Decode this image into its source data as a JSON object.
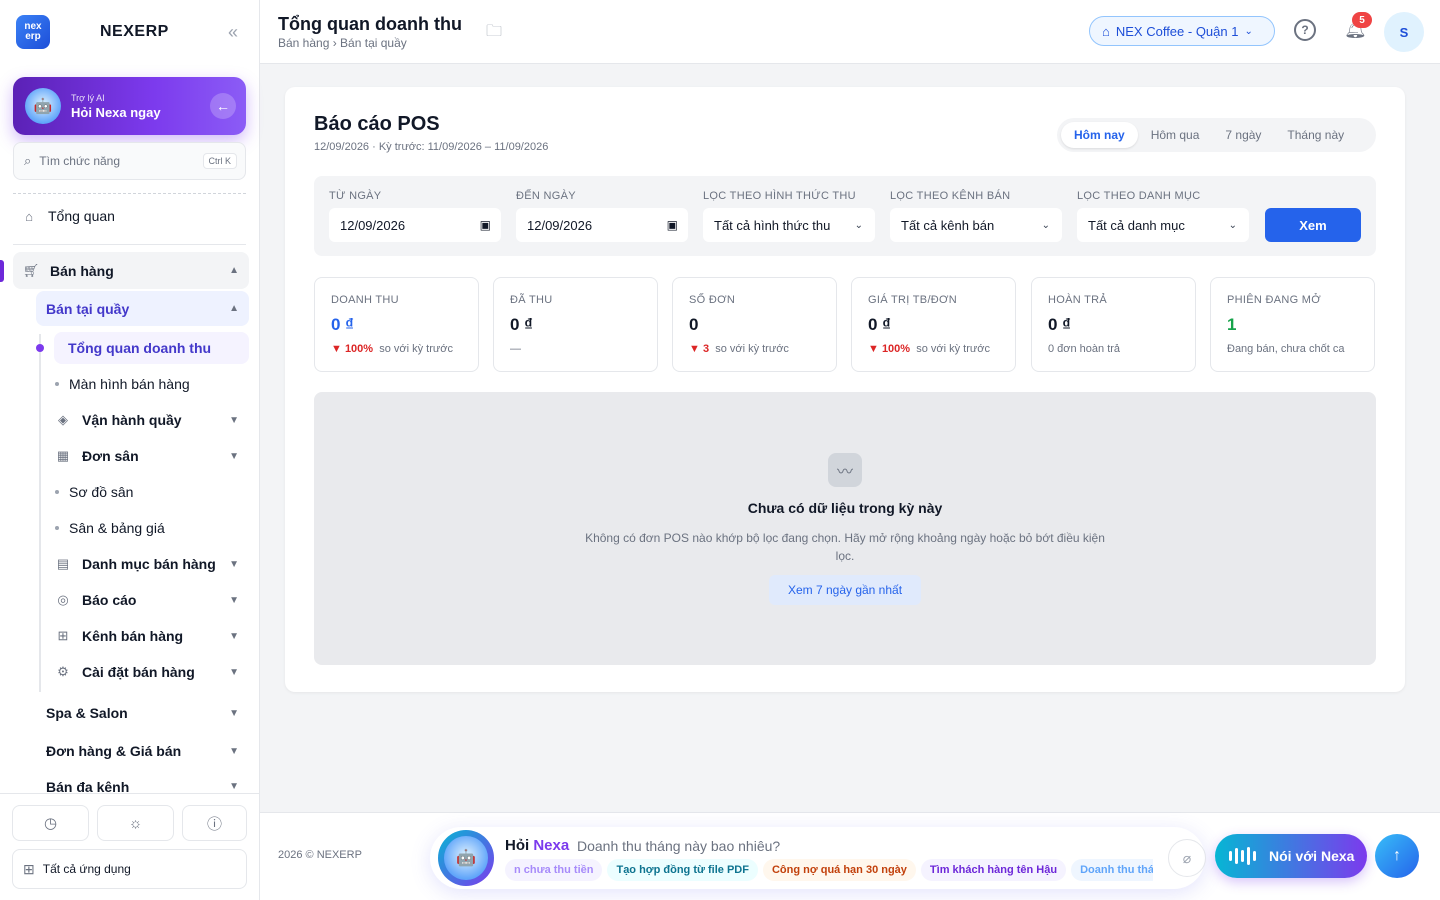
{
  "sidebar": {
    "logo_line1": "nex",
    "logo_line2": "erp",
    "brand": "NEXERP",
    "collapse_icon": "chevrons-left-icon",
    "ai": {
      "small": "Trợ lý AI",
      "big": "Hỏi Nexa ngay"
    },
    "search": {
      "placeholder": "Tìm chức năng",
      "shortcut": "Ctrl K"
    },
    "overview": "Tổng quan",
    "sales": "Bán hàng",
    "pos": "Bán tại quầy",
    "pos_overview": "Tổng quan doanh thu",
    "pos_screen": "Màn hình bán hàng",
    "counter_ops": "Vận hành quầy",
    "court_orders": "Đơn sân",
    "court_map": "Sơ đồ sân",
    "court_prices": "Sân & bảng giá",
    "sales_catalog": "Danh mục bán hàng",
    "reports": "Báo cáo",
    "sales_channels": "Kênh bán hàng",
    "sales_settings": "Cài đặt bán hàng",
    "spa": "Spa & Salon",
    "orders_prices": "Đơn hàng & Giá bán",
    "omni": "Bán đa kênh",
    "all_apps": "Tất cả ứng dụng"
  },
  "topbar": {
    "title": "Tổng quan doanh thu",
    "breadcrumb": "Bán hàng › Bán tại quầy",
    "store": "NEX Coffee - Quận 1",
    "notif_count": "5",
    "avatar": "S"
  },
  "report": {
    "title": "Báo cáo POS",
    "subtitle": "12/09/2026 · Kỳ trước: 11/09/2026 – 11/09/2026",
    "periods": [
      "Hôm nay",
      "Hôm qua",
      "7 ngày",
      "Tháng này"
    ],
    "filters": {
      "from_label": "TỪ NGÀY",
      "from_value": "12/09/2026",
      "to_label": "ĐẾN NGÀY",
      "to_value": "12/09/2026",
      "method_label": "LỌC THEO HÌNH THỨC THU",
      "method_value": "Tất cả hình thức thu",
      "channel_label": "LỌC THEO KÊNH BÁN",
      "channel_value": "Tất cả kênh bán",
      "category_label": "LỌC THEO DANH MỤC",
      "category_value": "Tất cả danh mục",
      "submit": "Xem"
    },
    "stats": [
      {
        "label": "DOANH THU",
        "value": "0 ₫",
        "delta": "▼ 100%",
        "note": "so với kỳ trước"
      },
      {
        "label": "ĐÃ THU",
        "value": "0 ₫",
        "delta": "",
        "note": "—"
      },
      {
        "label": "SỐ ĐƠN",
        "value": "0",
        "delta": "▼ 3",
        "note": "so với kỳ trước"
      },
      {
        "label": "GIÁ TRỊ TB/ĐƠN",
        "value": "0 ₫",
        "delta": "▼ 100%",
        "note": "so với kỳ trước"
      },
      {
        "label": "HOÀN TRẢ",
        "value": "0 ₫",
        "delta": "",
        "note": "0 đơn hoàn trả"
      },
      {
        "label": "PHIÊN ĐANG MỞ",
        "value": "1",
        "delta": "",
        "note": "Đang bán, chưa chốt ca"
      }
    ],
    "empty": {
      "title": "Chưa có dữ liệu trong kỳ này",
      "desc": "Không có đơn POS nào khớp bộ lọc đang chọn. Hãy mở rộng khoảng ngày hoặc bỏ bớt điều kiện lọc.",
      "action": "Xem 7 ngày gần nhất"
    }
  },
  "footer": {
    "copyright": "2026 © NEXERP",
    "ask_prefix": "Hỏi",
    "ask_name": "Nexa",
    "ask_question": "Doanh thu tháng này bao nhiêu?",
    "chips": [
      "n chưa thu tiền",
      "Tạo hợp đồng từ file PDF",
      "Công nợ quá hạn 30 ngày",
      "Tìm khách hàng tên Hậu",
      "Doanh thu thá"
    ],
    "voice": "Nói với Nexa"
  }
}
